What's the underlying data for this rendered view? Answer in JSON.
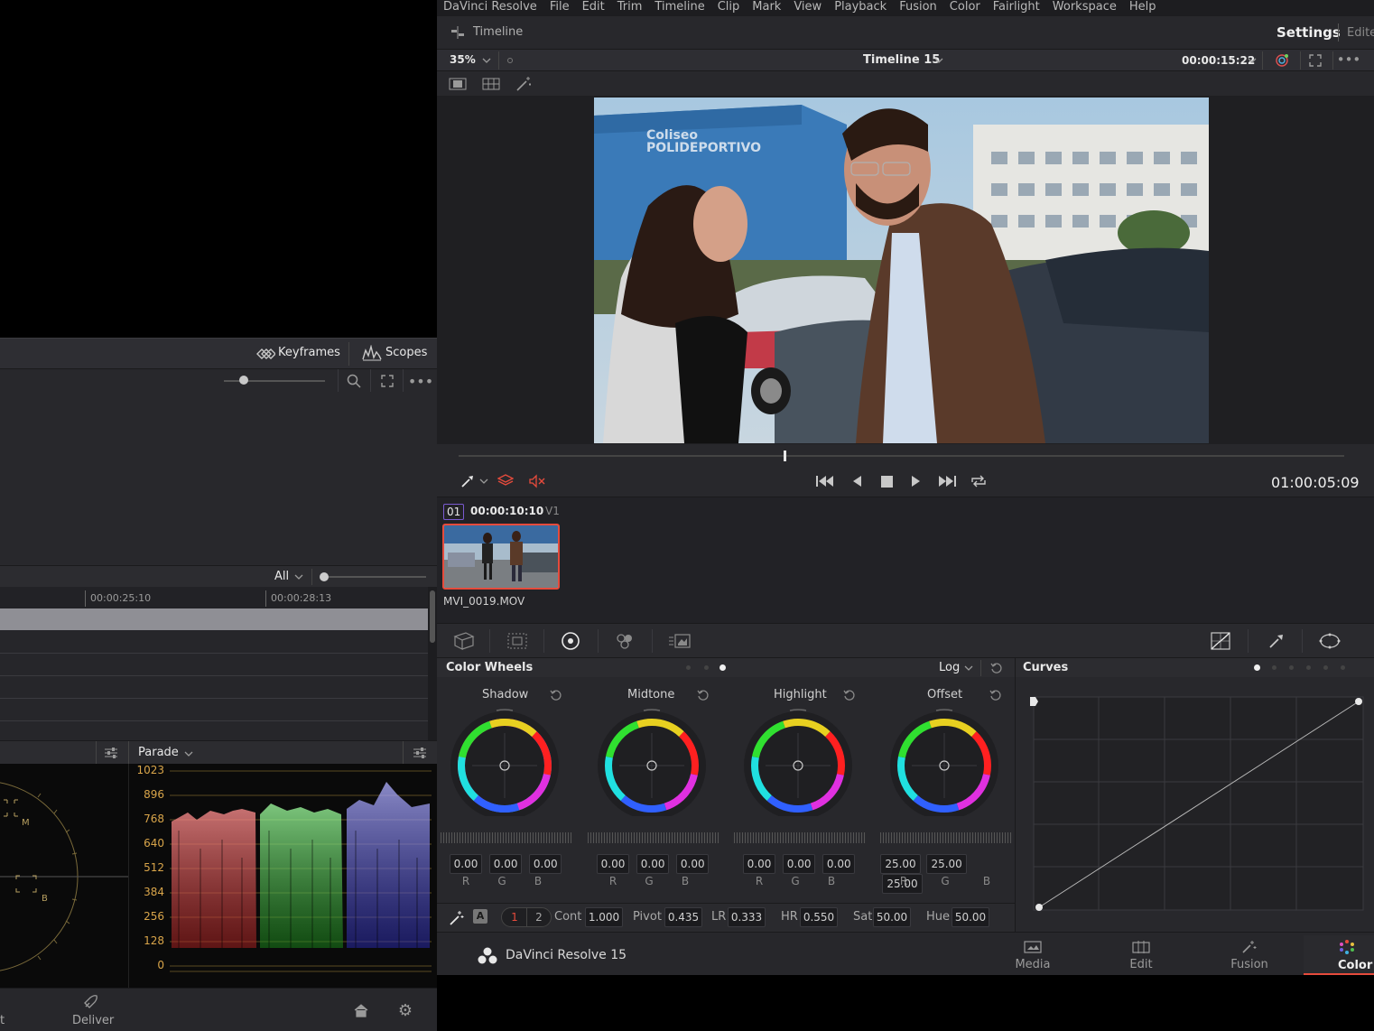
{
  "menu": {
    "app": "DaVinci Resolve",
    "items": [
      "File",
      "Edit",
      "Trim",
      "Timeline",
      "Clip",
      "Mark",
      "View",
      "Playback",
      "Fusion",
      "Color",
      "Fairlight",
      "Workspace",
      "Help"
    ]
  },
  "header": {
    "timeline_label": "Timeline",
    "settings": "Settings",
    "edit": "Edite"
  },
  "viewer": {
    "zoom": "35%",
    "timeline_name": "Timeline 15",
    "timecode_top": "00:00:15:22",
    "timecode_main": "01:00:05:09"
  },
  "left_panel": {
    "keyframes": "Keyframes",
    "scopes": "Scopes",
    "all_filter": "All",
    "ruler": [
      "00:00:25:10",
      "00:00:28:13"
    ],
    "parade": "Parade",
    "parade_ticks": [
      "1023",
      "896",
      "768",
      "640",
      "512",
      "384",
      "256",
      "128",
      "0"
    ]
  },
  "clip": {
    "number": "01",
    "timecode": "00:00:10:10",
    "track": "V1",
    "name": "MVI_0019.MOV"
  },
  "color_wheels": {
    "title": "Color Wheels",
    "mode": "Log",
    "wheels": [
      {
        "name": "Shadow",
        "r": "0.00",
        "g": "0.00",
        "b": "0.00"
      },
      {
        "name": "Midtone",
        "r": "0.00",
        "g": "0.00",
        "b": "0.00"
      },
      {
        "name": "Highlight",
        "r": "0.00",
        "g": "0.00",
        "b": "0.00"
      },
      {
        "name": "Offset",
        "r": "25.00",
        "g": "25.00",
        "b": "25.00"
      }
    ],
    "channel_labels": [
      "R",
      "G",
      "B"
    ]
  },
  "adjust": {
    "auto": "A",
    "page1": "1",
    "page2": "2",
    "cont_label": "Cont",
    "cont": "1.000",
    "pivot_label": "Pivot",
    "pivot": "0.435",
    "lr_label": "LR",
    "lr": "0.333",
    "hr_label": "HR",
    "hr": "0.550",
    "sat_label": "Sat",
    "sat": "50.00",
    "hue_label": "Hue",
    "hue": "50.00"
  },
  "curves": {
    "title": "Curves"
  },
  "footer": {
    "brand": "DaVinci Resolve 15",
    "tabs": [
      "Media",
      "Edit",
      "Fusion",
      "Color"
    ],
    "left_tab": "Deliver",
    "left_partial": "t"
  },
  "colors": {
    "accent": "#e64b3c",
    "bg_panel": "#26262a",
    "tick_orange": "#d9a54a"
  }
}
